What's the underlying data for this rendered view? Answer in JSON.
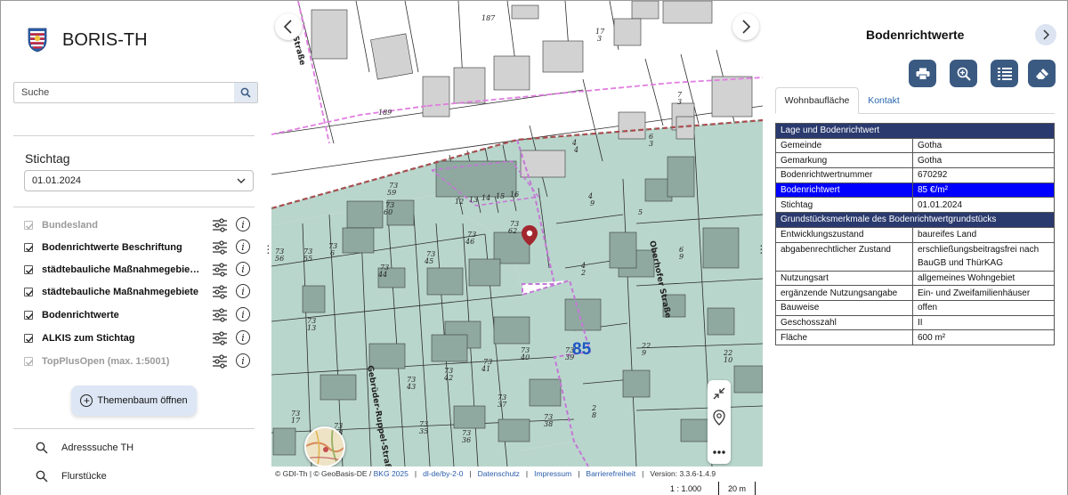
{
  "app": {
    "title": "BORIS-TH",
    "logo_icon": "thuringia-coat-of-arms-icon"
  },
  "sidebar": {
    "search": {
      "placeholder": "Suche"
    },
    "stichtag": {
      "label": "Stichtag",
      "selected": "01.01.2024"
    },
    "layers": [
      {
        "label": "Bundesland",
        "checked": true,
        "disabled": true
      },
      {
        "label": "Bodenrichtwerte Beschriftung",
        "checked": true,
        "disabled": false
      },
      {
        "label": "städtebauliche Maßnahmegebiete Be...",
        "checked": true,
        "disabled": false
      },
      {
        "label": "städtebauliche Maßnahmegebiete",
        "checked": true,
        "disabled": false
      },
      {
        "label": "Bodenrichtwerte",
        "checked": true,
        "disabled": false
      },
      {
        "label": "ALKIS zum Stichtag",
        "checked": true,
        "disabled": false
      },
      {
        "label": "TopPlusOpen (max. 1:5001)",
        "checked": true,
        "disabled": true
      }
    ],
    "themenbaum_button": "Themenbaum öffnen",
    "tools": [
      {
        "label": "Adresssuche TH",
        "icon": "search-icon"
      },
      {
        "label": "Flurstücke",
        "icon": "search-icon"
      }
    ]
  },
  "map": {
    "zone_value": "85",
    "street_labels": [
      "Oberhofer Straße",
      "Gebrüder-Ruppel-Straße",
      "Straße"
    ],
    "parcel_labels": [
      "187",
      "189",
      "73/59",
      "73/60",
      "73/56",
      "73/55",
      "73/6",
      "73/44",
      "73/45",
      "73/46",
      "73/62",
      "73/13",
      "73/43",
      "73/42",
      "73/41",
      "73/40",
      "73/39",
      "73/37",
      "73/38",
      "73/36",
      "73/35",
      "73/18",
      "73/17",
      "4/9",
      "4/2",
      "6/9",
      "22/9",
      "22/10",
      "2/8",
      "7/3",
      "6/3",
      "17/3",
      "2/8"
    ],
    "attribution": {
      "prefix": "© GDI-Th | © GeoBasis-DE /",
      "bkg": "BKG 2025",
      "license": "dl-de/by-2-0",
      "datenschutz": "Datenschutz",
      "impressum": "Impressum",
      "barrierefreiheit": "Barrierefreiheit",
      "version": "Version: 3.3.6-1.4.9"
    },
    "scale": {
      "ratio": "1 : 1.000",
      "distance": "20 m"
    },
    "colors": {
      "zone_fill": "#b9d6cc",
      "building": "#8fa9a0",
      "boundary_pink": "#e07ee0",
      "boundary_red": "#b0474f",
      "zone_label": "#1e56c4"
    }
  },
  "panel": {
    "title": "Bodenrichtwerte",
    "tabs": [
      {
        "label": "Wohnbaufläche",
        "active": true
      },
      {
        "label": "Kontakt",
        "active": false
      }
    ],
    "actions": [
      "print-icon",
      "zoom-icon",
      "table-icon",
      "eraser-icon"
    ],
    "sections": [
      {
        "heading": "Lage und Bodenrichtwert",
        "rows": [
          {
            "key": "Gemeinde",
            "value": "Gotha"
          },
          {
            "key": "Gemarkung",
            "value": "Gotha"
          },
          {
            "key": "Bodenrichtwertnummer",
            "value": "670292"
          },
          {
            "key": "Bodenrichtwert",
            "value": "85 €/m²",
            "highlight": true
          },
          {
            "key": "Stichtag",
            "value": "01.01.2024"
          }
        ]
      },
      {
        "heading": "Grundstücksmerkmale des Bodenrichtwertgrundstücks",
        "rows": [
          {
            "key": "Entwicklungszustand",
            "value": "baureifes Land"
          },
          {
            "key": "abgabenrechtlicher Zustand",
            "value": "erschließungsbeitragsfrei nach BauGB und ThürKAG",
            "tall": true
          },
          {
            "key": "Nutzungsart",
            "value": "allgemeines Wohngebiet"
          },
          {
            "key": "ergänzende Nutzungsangabe",
            "value": "Ein- und Zweifamilienhäuser"
          },
          {
            "key": "Bauweise",
            "value": "offen"
          },
          {
            "key": "Geschosszahl",
            "value": "II"
          },
          {
            "key": "Fläche",
            "value": "600 m²"
          }
        ]
      }
    ]
  }
}
